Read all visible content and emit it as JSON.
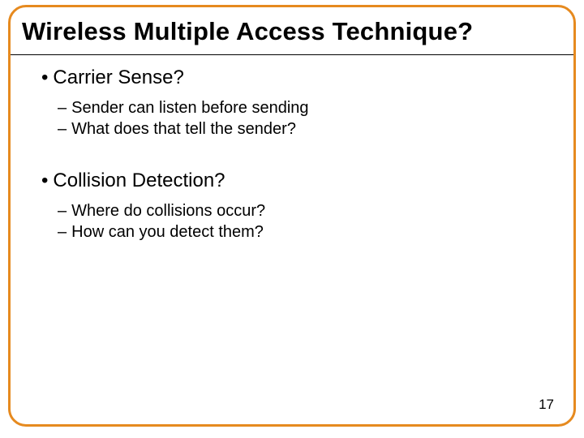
{
  "colors": {
    "border": "#e68a1f"
  },
  "title": "Wireless Multiple Access Technique?",
  "bullets": [
    {
      "text": "Carrier Sense?",
      "subs": [
        "Sender can listen before sending",
        "What does that tell the sender?"
      ]
    },
    {
      "text": "Collision Detection?",
      "subs": [
        "Where do collisions occur?",
        "How can you detect them?"
      ]
    }
  ],
  "page_number": "17"
}
